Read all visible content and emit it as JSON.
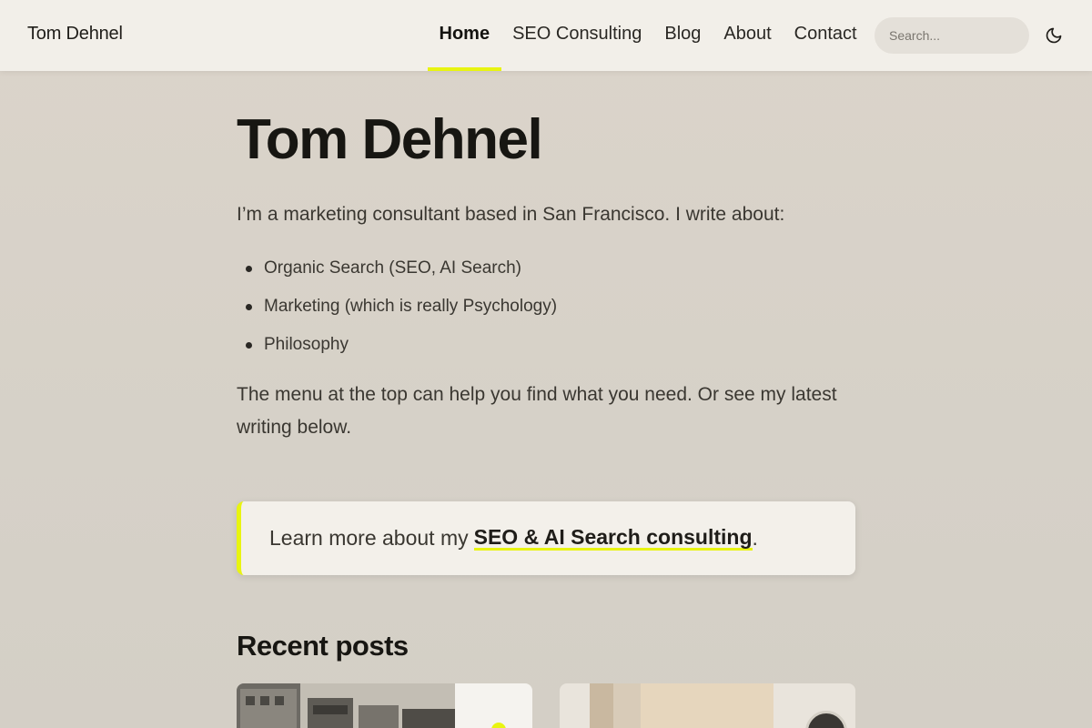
{
  "header": {
    "brand": "Tom Dehnel",
    "nav": [
      {
        "label": "Home",
        "active": true
      },
      {
        "label": "SEO Consulting",
        "active": false
      },
      {
        "label": "Blog",
        "active": false
      },
      {
        "label": "About",
        "active": false
      },
      {
        "label": "Contact",
        "active": false
      }
    ],
    "search_placeholder": "Search...",
    "theme_toggle_icon": "moon-icon"
  },
  "main": {
    "title": "Tom Dehnel",
    "intro": "I’m a marketing consultant based in San Francisco. I write about:",
    "topics": [
      "Organic Search (SEO, AI Search)",
      "Marketing (which is really Psychology)",
      "Philosophy"
    ],
    "menu_text": "The menu at the top can help you find what you need. Or see my latest writing below.",
    "callout": {
      "prefix": "Learn more about my",
      "link": "SEO & AI Search consulting",
      "suffix": "."
    },
    "recent_title": "Recent posts"
  },
  "colors": {
    "accent": "#e8f411",
    "background": "#d6d1c8",
    "header_bg": "#f2efe9"
  }
}
